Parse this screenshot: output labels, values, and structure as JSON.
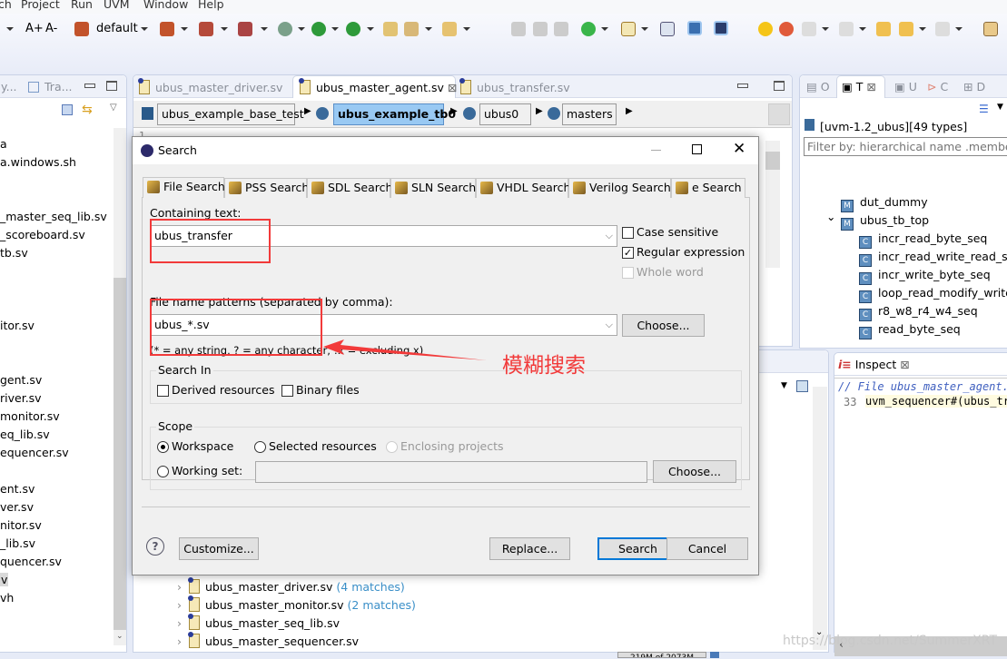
{
  "menu": [
    "ch",
    "Project",
    "Run",
    "UVM",
    "Window",
    "Help"
  ],
  "toolbar": {
    "font_inc": "A+",
    "font_dec": "A-",
    "config": "default"
  },
  "left_panel": {
    "tabs": [
      "y...",
      "Tra..."
    ],
    "items": [
      "a",
      "a.windows.sh",
      "_master_seq_lib.sv",
      "_scoreboard.sv",
      "tb.sv",
      "itor.sv",
      "gent.sv",
      "river.sv",
      "monitor.sv",
      "eq_lib.sv",
      "equencer.sv",
      "ent.sv",
      "ver.sv",
      "nitor.sv",
      "_lib.sv",
      "quencer.sv",
      "v",
      "vh"
    ]
  },
  "editor": {
    "tabs": [
      "ubus_master_driver.sv",
      "ubus_master_agent.sv",
      "ubus_transfer.sv"
    ],
    "active_tab": 1,
    "breadcrumb": [
      "ubus_example_base_test",
      "ubus_example_tb0",
      "ubus0",
      "masters"
    ],
    "line_number": "1"
  },
  "right_panel": {
    "tabs": [
      "O",
      "T",
      "U",
      "C",
      "D"
    ],
    "project": "[uvm-1.2_ubus][49 types]",
    "filter_placeholder": "Filter by: hierarchical name .member",
    "tree": [
      {
        "label": "dut_dummy",
        "icon": "M",
        "level": 0
      },
      {
        "label": "ubus_tb_top",
        "icon": "M",
        "level": 0,
        "expanded": true
      },
      {
        "label": "incr_read_byte_seq",
        "icon": "C",
        "level": 1
      },
      {
        "label": "incr_read_write_read_seq",
        "icon": "C",
        "level": 1
      },
      {
        "label": "incr_write_byte_seq",
        "icon": "C",
        "level": 1
      },
      {
        "label": "loop_read_modify_write_seq",
        "icon": "C",
        "level": 1
      },
      {
        "label": "r8_w8_r4_w4_seq",
        "icon": "C",
        "level": 1
      },
      {
        "label": "read_byte_seq",
        "icon": "C",
        "level": 1
      }
    ]
  },
  "inspect": {
    "title": "Inspect",
    "comment": "// File ubus_master_agent.sv",
    "line_no": "33",
    "code": "uvm_sequencer#(ubus_transfer)"
  },
  "results": [
    {
      "file": "ubus_master_driver.sv",
      "matches": "(4 matches)"
    },
    {
      "file": "ubus_master_monitor.sv",
      "matches": "(2 matches)"
    },
    {
      "file": "ubus_master_seq_lib.sv",
      "matches": ""
    },
    {
      "file": "ubus_master_sequencer.sv",
      "matches": ""
    }
  ],
  "status": {
    "memory": "219M of 2073M"
  },
  "watermark": "https://blog.csdn.net/SummerXRT",
  "dialog": {
    "title": "Search",
    "tabs": [
      "File Search",
      "PSS Search",
      "SDL Search",
      "SLN Search",
      "VHDL Search",
      "Verilog Search",
      "e Search"
    ],
    "containing_label": "Containing text:",
    "containing_value": "ubus_transfer",
    "case_sensitive": {
      "label": "Case sensitive",
      "checked": false
    },
    "regex": {
      "label": "Regular expression",
      "checked": true
    },
    "whole_word": {
      "label": "Whole word",
      "checked": false,
      "disabled": true
    },
    "patterns_label": "File name patterns (separated by comma):",
    "patterns_value": "ubus_*.sv",
    "choose": "Choose...",
    "hint": "(* = any string, ? = any character, !x = excluding x)",
    "search_in": {
      "title": "Search In",
      "derived": "Derived resources",
      "binary": "Binary files"
    },
    "scope": {
      "title": "Scope",
      "workspace": "Workspace",
      "selected": "Selected resources",
      "enclosing": "Enclosing projects",
      "working_set": "Working set:",
      "choose": "Choose...",
      "selected_option": "Workspace"
    },
    "buttons": {
      "customize": "Customize...",
      "replace": "Replace...",
      "search": "Search",
      "cancel": "Cancel"
    }
  },
  "annotation": {
    "text": "模糊搜索",
    "color": "#f23a3a"
  }
}
